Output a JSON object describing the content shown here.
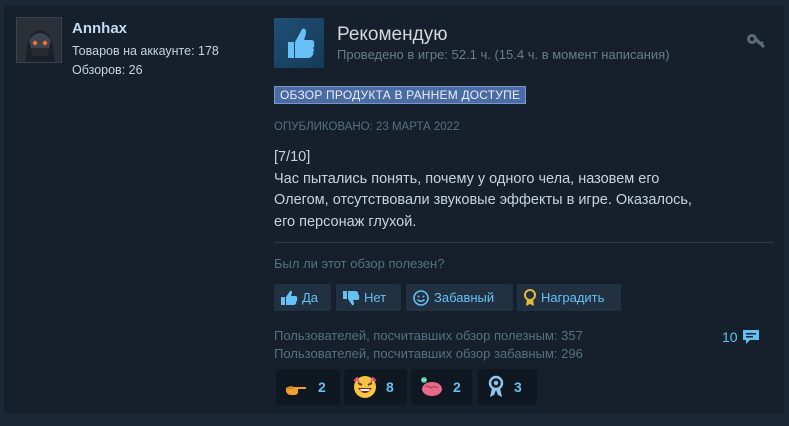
{
  "author": {
    "name": "Annhax",
    "products_label": "Товаров на аккаунте: 178",
    "reviews_label": "Обзоров: 26"
  },
  "review": {
    "verdict": "Рекомендую",
    "hours": "Проведено в игре: 52.1 ч. (15.4 ч. в момент написания)",
    "badge": "ОБЗОР ПРОДУКТА В РАННЕМ ДОСТУПЕ",
    "posted": "ОПУБЛИКОВАНО: 23 МАРТА 2022",
    "body_lines": [
      "[7/10]",
      "Час пытались понять, почему у одного чела, назовем его",
      "Олегом, отсутствовали звуковые эффекты в игре. Оказалось,",
      "его персонаж глухой."
    ]
  },
  "helpful": {
    "question": "Был ли этот обзор полезен?",
    "yes": "Да",
    "no": "Нет",
    "funny": "Забавный",
    "award": "Наградить"
  },
  "stats": {
    "helpful_line": "Пользователей, посчитавших обзор полезным: 357",
    "funny_line": "Пользователей, посчитавших обзор забавным: 296",
    "comments": "10"
  },
  "awards": [
    {
      "icon": "pointing-hand-icon",
      "count": "2"
    },
    {
      "icon": "laughing-face-icon",
      "count": "8"
    },
    {
      "icon": "mind-blown-icon",
      "count": "2"
    },
    {
      "icon": "ribbon-icon",
      "count": "3"
    }
  ],
  "colors": {
    "background": "#1b2838",
    "card": "#16202d",
    "link_blue": "#66c0f4",
    "badge_bg": "#4b6ba3"
  }
}
